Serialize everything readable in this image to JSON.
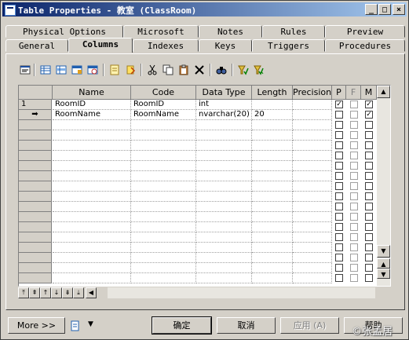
{
  "window": {
    "title": "Table Properties - 教室 (ClassRoom)",
    "controls": [
      "_",
      "□",
      "×"
    ]
  },
  "tabs_back": [
    "Physical Options",
    "Microsoft",
    "Notes",
    "Rules",
    "Preview"
  ],
  "tabs_front": [
    "General",
    "Columns",
    "Indexes",
    "Keys",
    "Triggers",
    "Procedures"
  ],
  "active_tab": "Columns",
  "toolbar": {
    "icons": [
      "properties-icon",
      "add-row-icon",
      "insert-row-icon",
      "add-columns-icon",
      "reuse-columns-icon",
      "new-icon",
      "paste-icon",
      "cut-icon",
      "copy-icon",
      "paste-clipboard-icon",
      "delete-icon",
      "find-icon",
      "filter-icon",
      "clear-filter-icon"
    ]
  },
  "grid": {
    "columns": [
      "Name",
      "Code",
      "Data Type",
      "Length",
      "Precision",
      "P",
      "F",
      "M"
    ],
    "rows": [
      {
        "marker": "1",
        "name": "RoomID",
        "code": "RoomID",
        "type": "int",
        "length": "",
        "precision": "",
        "P": true,
        "F": false,
        "M": true
      },
      {
        "marker": "➡",
        "name": "RoomName",
        "code": "RoomName",
        "type": "nvarchar(20)",
        "length": "20",
        "precision": "",
        "P": false,
        "F": false,
        "M": true
      }
    ],
    "empty_rows": 16
  },
  "footer": {
    "more": "More >>",
    "ok": "确定",
    "cancel": "取消",
    "apply": "应用 (A)",
    "help": "帮助"
  },
  "watermark": "©张孟居"
}
